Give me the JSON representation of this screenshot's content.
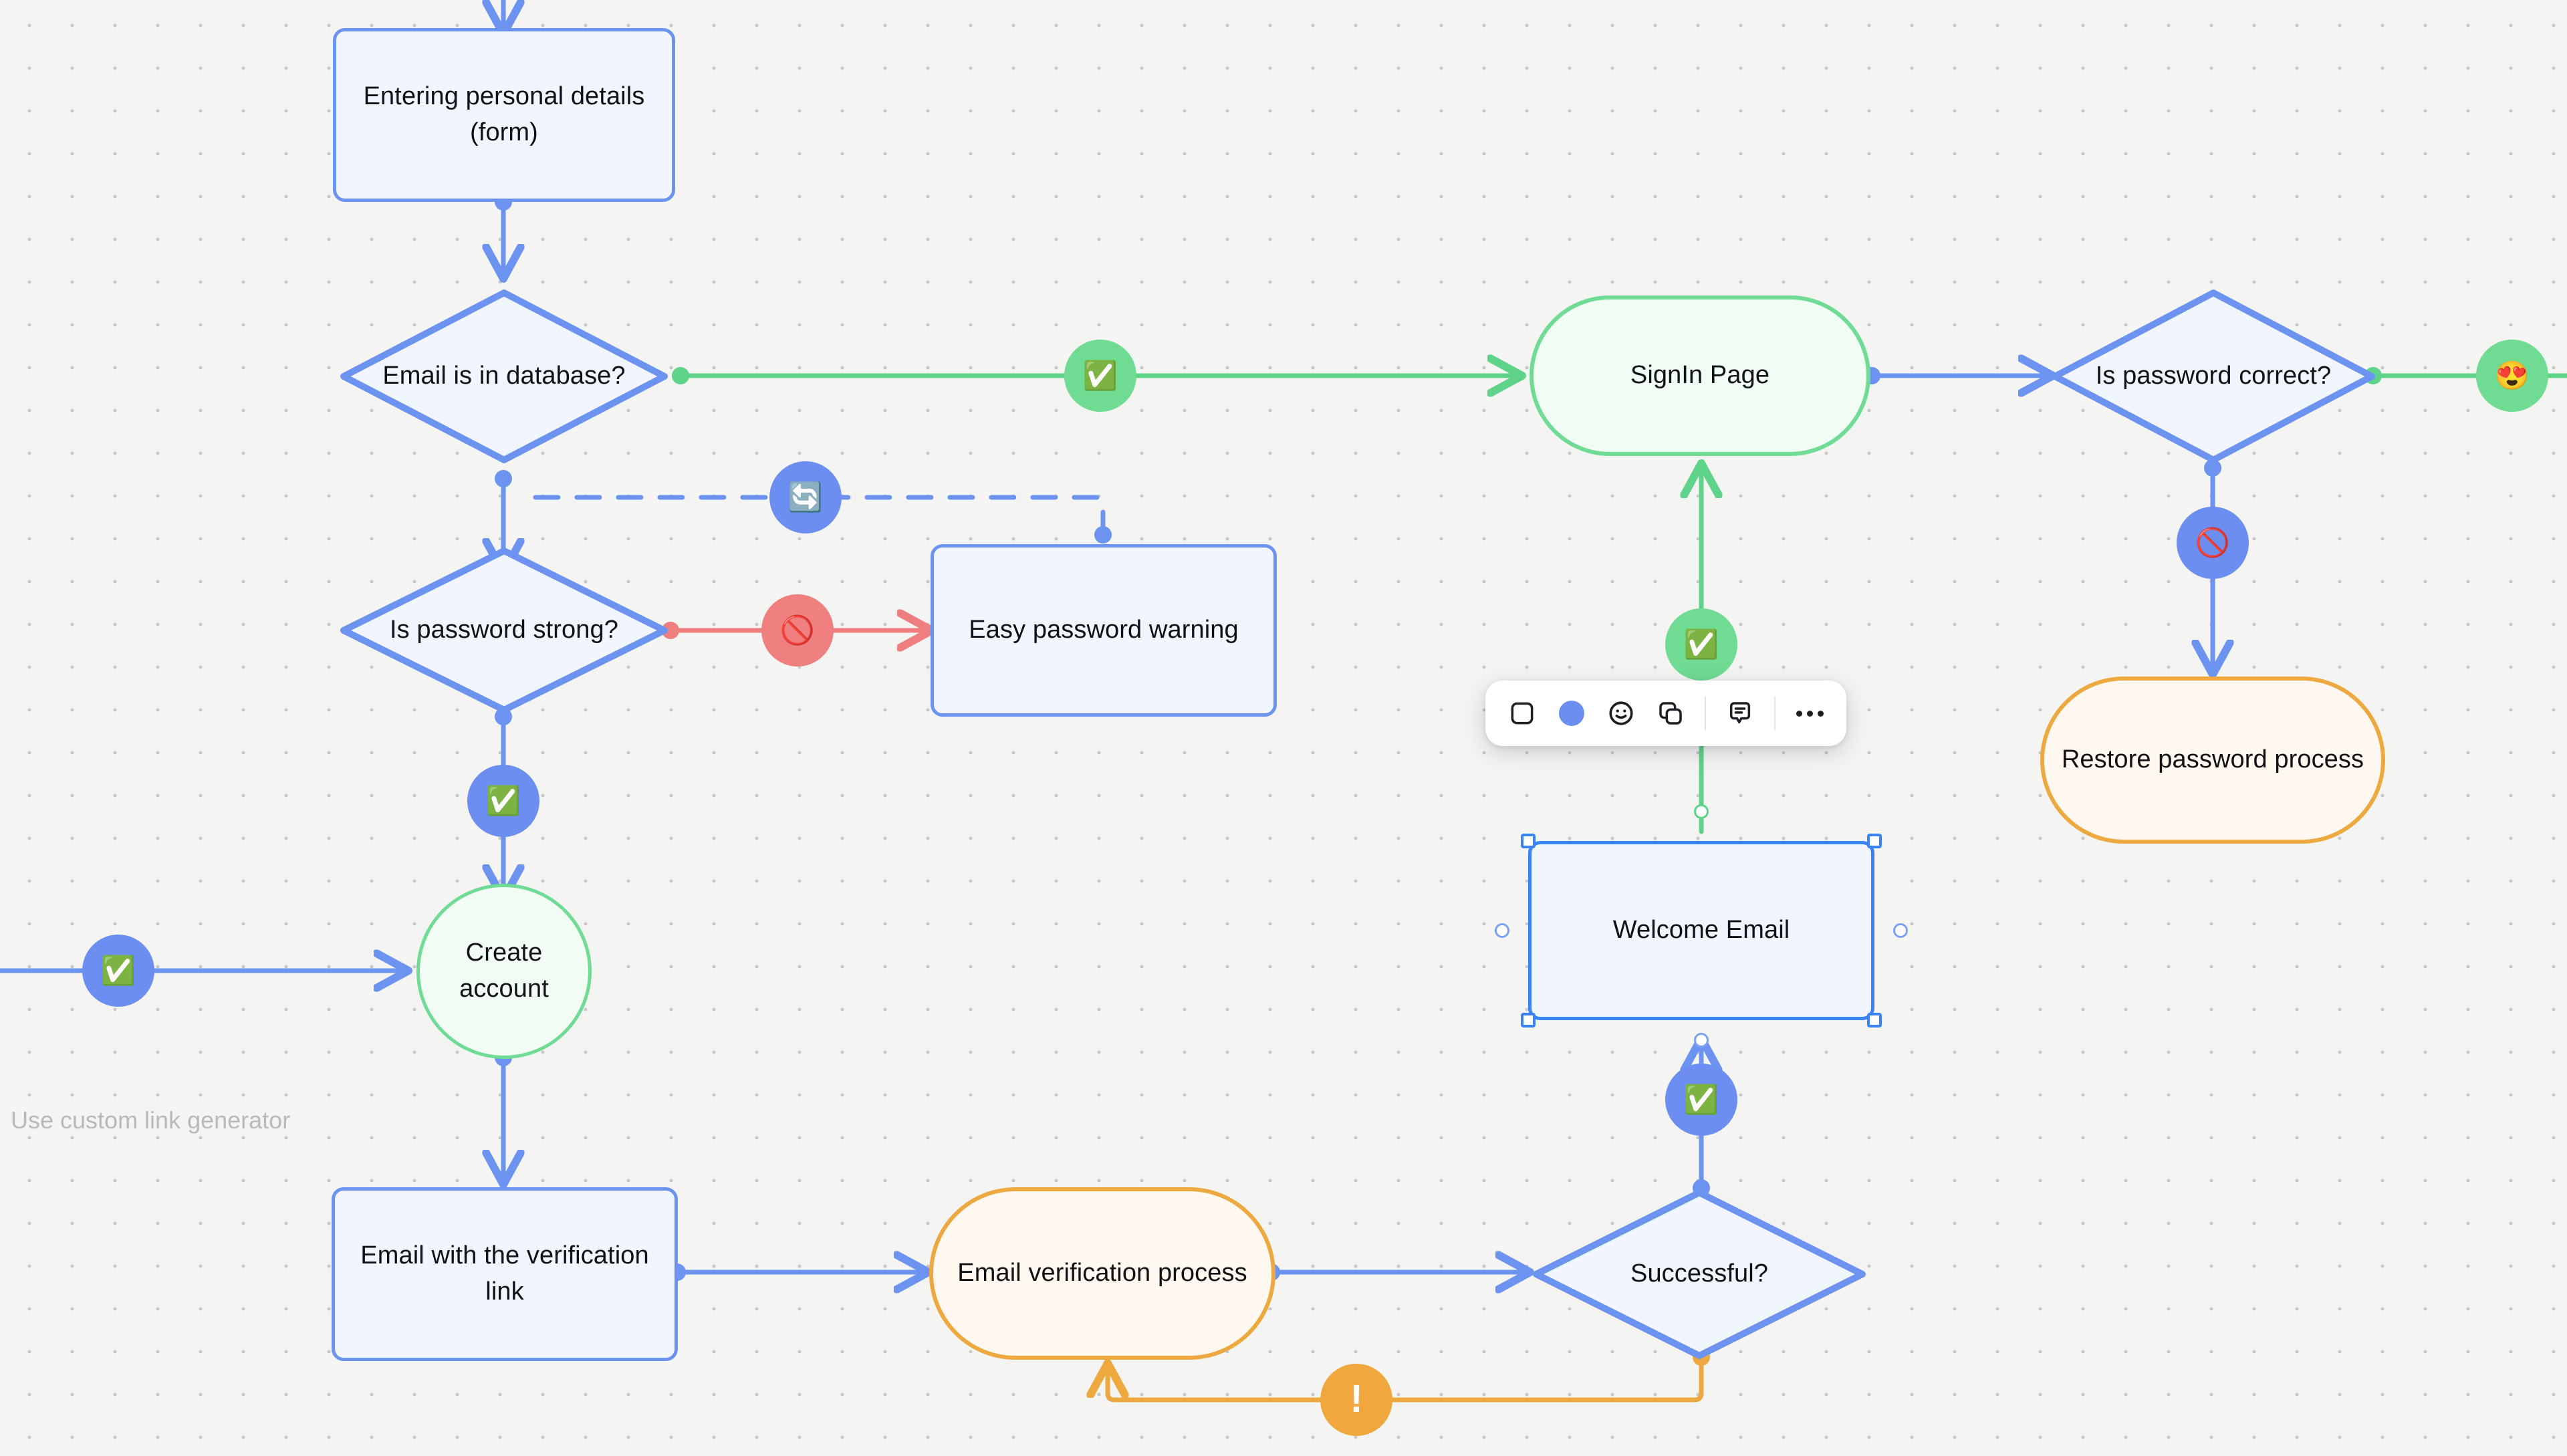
{
  "canvas": {
    "background_color": "#f4f4f3",
    "grid_dot_color": "#c9c9c9",
    "caption": "Use custom link generator"
  },
  "palette": {
    "node_blue_border": "#6c93f0",
    "node_blue_fill": "#f1f5fd",
    "node_green_border": "#6fdb95",
    "node_green_fill": "#f1fcf4",
    "node_orange_border": "#eda93f",
    "node_orange_fill": "#fef8f0",
    "edge_blue": "#6c93f0",
    "edge_green": "#5fd38a",
    "edge_red": "#ef7f7f",
    "edge_orange": "#eda93f",
    "selection_blue": "#3b82f6",
    "caption_gray": "#b7b9bd"
  },
  "nodes": [
    {
      "id": "entering-personal-details",
      "label": "Entering personal details (form)",
      "shape": "rectangle",
      "color": "blue"
    },
    {
      "id": "email-is-in-database",
      "label": "Email is in database?",
      "shape": "diamond",
      "color": "blue"
    },
    {
      "id": "is-password-strong",
      "label": "Is password strong?",
      "shape": "diamond",
      "color": "blue"
    },
    {
      "id": "easy-password-warning",
      "label": "Easy password warning",
      "shape": "rectangle",
      "color": "blue"
    },
    {
      "id": "create-account",
      "label": "Create account",
      "shape": "circle",
      "color": "green"
    },
    {
      "id": "email-with-verification-link",
      "label": "Email with the verification link",
      "shape": "rectangle",
      "color": "blue"
    },
    {
      "id": "email-verification-process",
      "label": "Email verification process",
      "shape": "pill",
      "color": "orange"
    },
    {
      "id": "successful",
      "label": "Successful?",
      "shape": "diamond",
      "color": "blue"
    },
    {
      "id": "welcome-email",
      "label": "Welcome Email",
      "shape": "rectangle",
      "color": "blue",
      "selected": true
    },
    {
      "id": "signin-page",
      "label": "SignIn Page",
      "shape": "pill",
      "color": "green"
    },
    {
      "id": "is-password-correct",
      "label": "Is password correct?",
      "shape": "diamond",
      "color": "blue"
    },
    {
      "id": "restore-password-process",
      "label": "Restore password process",
      "shape": "pill",
      "color": "orange"
    }
  ],
  "edge_badges": [
    {
      "id": "badge-db-yes",
      "emoji": "✅",
      "chip_color": "#6fdb93",
      "on_edge": "email-is-in-database → signin-page"
    },
    {
      "id": "badge-warning-loop",
      "emoji": "🔄",
      "chip_color": "#6b8ef0",
      "on_edge": "easy-password-warning → is-password-strong"
    },
    {
      "id": "badge-weak-password",
      "emoji": "🚫",
      "chip_color": "#f08080",
      "on_edge": "is-password-strong → easy-password-warning"
    },
    {
      "id": "badge-strong-password",
      "emoji": "✅",
      "chip_color": "#6b8ef0",
      "on_edge": "is-password-strong → create-account"
    },
    {
      "id": "badge-incoming-left",
      "emoji": "✅",
      "chip_color": "#6b8ef0",
      "on_edge": "offscreen → create-account"
    },
    {
      "id": "badge-welcome-to-signin",
      "emoji": "✅",
      "chip_color": "#6fdb93",
      "on_edge": "welcome-email → signin-page"
    },
    {
      "id": "badge-successful-yes",
      "emoji": "✅",
      "chip_color": "#6b8ef0",
      "on_edge": "successful → welcome-email"
    },
    {
      "id": "badge-successful-no",
      "emoji": "❗",
      "chip_color": "#efa73e",
      "on_edge": "successful → email-verification-process"
    },
    {
      "id": "badge-password-wrong",
      "emoji": "🚫",
      "chip_color": "#6b8ef0",
      "on_edge": "is-password-correct → restore-password-process"
    },
    {
      "id": "badge-password-right",
      "emoji": "😍",
      "chip_color": "#6fdb93",
      "on_edge": "is-password-correct → offscreen"
    }
  ],
  "toolbar": {
    "items": [
      {
        "id": "shape-tool",
        "icon": "rounded-square-icon",
        "label": "Shape"
      },
      {
        "id": "color-tool",
        "icon": "color-swatch-icon",
        "label": "Color",
        "value": "#6b8ef0"
      },
      {
        "id": "emoji-tool",
        "icon": "smiley-icon",
        "label": "Emoji"
      },
      {
        "id": "duplicate-tool",
        "icon": "duplicate-icon",
        "label": "Duplicate"
      },
      {
        "id": "comment-tool",
        "icon": "comment-icon",
        "label": "Comment"
      },
      {
        "id": "more-tool",
        "icon": "more-horizontal-icon",
        "label": "More"
      }
    ]
  }
}
